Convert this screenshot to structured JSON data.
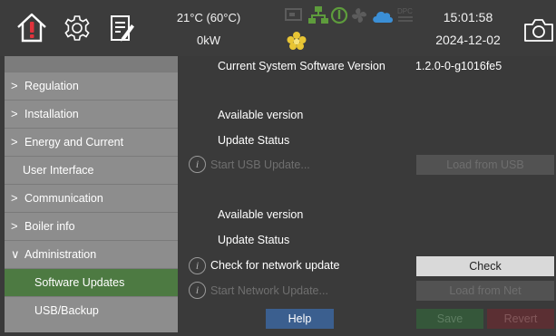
{
  "colors": {
    "background": "#3a3a3a",
    "sidebar": "#8d8d8d",
    "sidebar_active": "#4d7a42",
    "help_button": "#3b5f8f",
    "check_button": "#d9d9d9",
    "home_alert": "#e0323c"
  },
  "topbar": {
    "icons": [
      "home-alert-icon",
      "settings-gear-icon",
      "notes-edit-icon",
      "camera-icon"
    ],
    "status_icons": [
      "monitor-icon",
      "network-icon",
      "power-icon",
      "fan-icon",
      "cloud-icon",
      "dpc-icon",
      "flower-icon"
    ],
    "status_icon_texts": {
      "dpc": "DPC"
    },
    "temperature": "21°C (60°C)",
    "power": "0kW",
    "time": "15:01:58",
    "date": "2024-12-02"
  },
  "sidebar": {
    "items": [
      {
        "label": "Regulation",
        "chevron": ">"
      },
      {
        "label": "Installation",
        "chevron": ">"
      },
      {
        "label": "Energy and Current",
        "chevron": ">"
      },
      {
        "label": "User Interface",
        "chevron": ""
      },
      {
        "label": "Communication",
        "chevron": ">"
      },
      {
        "label": "Boiler info",
        "chevron": ">"
      },
      {
        "label": "Administration",
        "chevron": "∨"
      },
      {
        "label": "Software Updates",
        "chevron": "",
        "active": true
      },
      {
        "label": "USB/Backup",
        "chevron": ""
      }
    ]
  },
  "main": {
    "current_version_label": "Current System Software Version",
    "current_version_value": "1.2.0-0-g1016fe5",
    "usb": {
      "available_label": "Available version",
      "status_label": "Update Status",
      "start_label": "Start USB Update...",
      "load_button": "Load from USB"
    },
    "net": {
      "available_label": "Available version",
      "status_label": "Update Status",
      "check_label": "Check for network update",
      "check_button": "Check",
      "start_label": "Start Network Update...",
      "load_button": "Load from Net"
    },
    "info_glyph": "i",
    "help_button": "Help",
    "save_button": "Save",
    "revert_button": "Revert"
  }
}
